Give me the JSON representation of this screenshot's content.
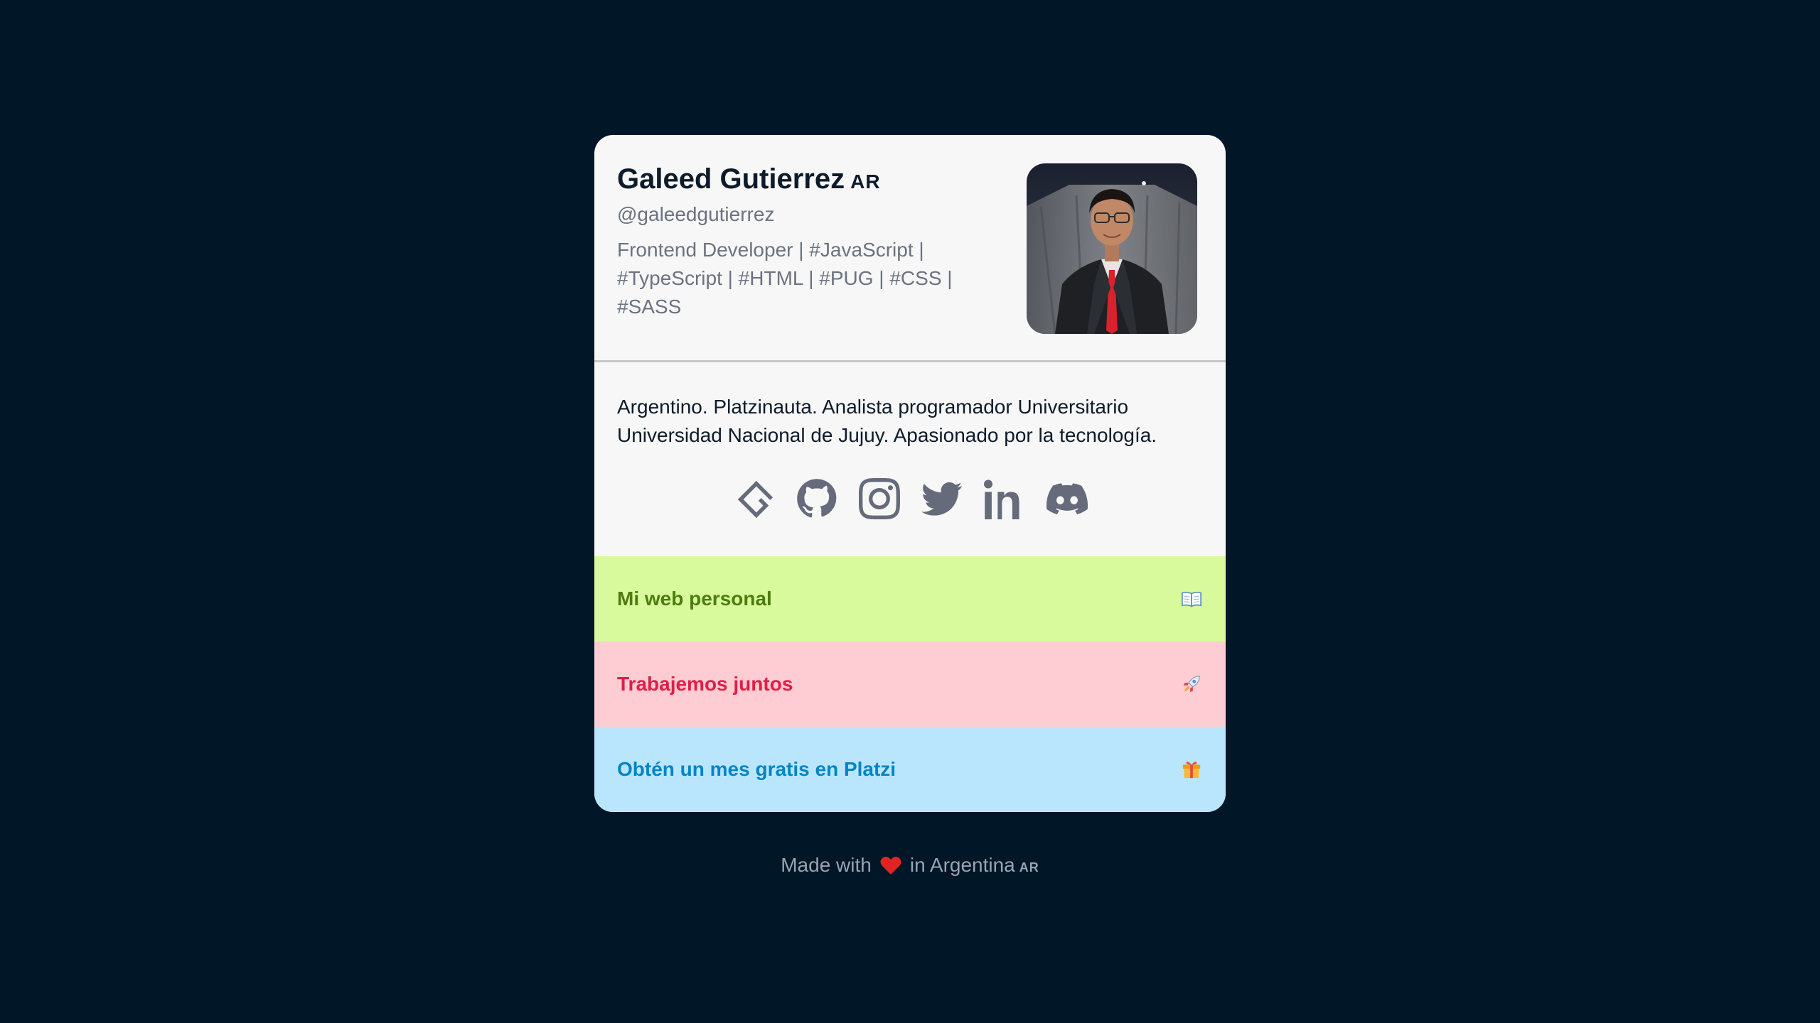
{
  "profile": {
    "name": "Galeed Gutierrez",
    "country_flag": "AR",
    "handle": "@galeedgutierrez",
    "headline": "Frontend Developer | #JavaScript | #TypeScript | #HTML | #PUG | #CSS | #SASS",
    "bio": "Argentino. Platzinauta. Analista programador Universitario Universidad Nacional de Jujuy. Apasionado por la tecnología."
  },
  "socials": [
    {
      "icon": "platzi-icon"
    },
    {
      "icon": "github-icon"
    },
    {
      "icon": "instagram-icon"
    },
    {
      "icon": "twitter-icon"
    },
    {
      "icon": "linkedin-icon"
    },
    {
      "icon": "discord-icon"
    }
  ],
  "links": [
    {
      "label": "Mi web personal",
      "icon": "book-icon",
      "bg": "#d9f99d",
      "color": "#4d7c0f"
    },
    {
      "label": "Trabajemos juntos",
      "icon": "rocket-icon",
      "bg": "#fecdd3",
      "color": "#e11d48"
    },
    {
      "label": "Obtén un mes gratis en Platzi",
      "icon": "gift-icon",
      "bg": "#bae6fd",
      "color": "#0284c7"
    }
  ],
  "footer": {
    "prefix": "Made with",
    "suffix": "in Argentina",
    "flag": "AR"
  },
  "colors": {
    "background": "#011627",
    "card": "#f7f7f7",
    "icon": "#656b7a"
  }
}
